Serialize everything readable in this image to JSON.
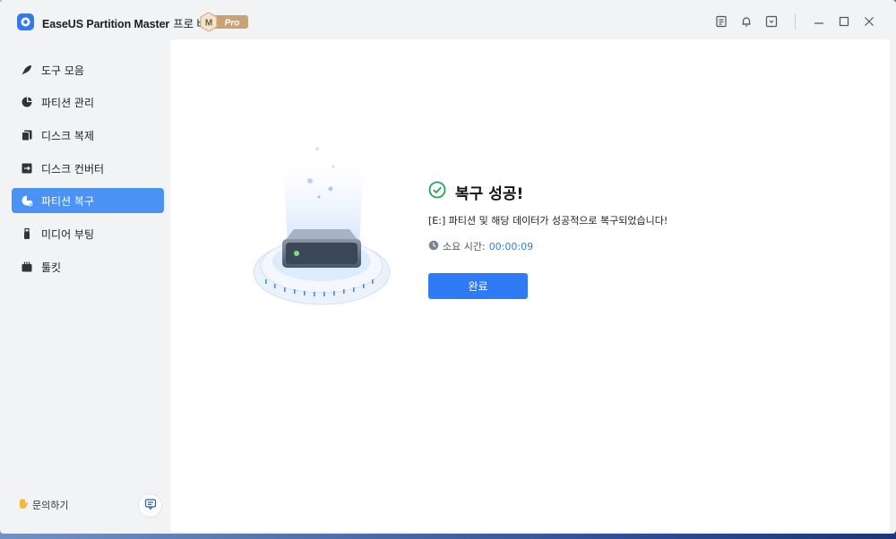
{
  "app": {
    "name": "EaseUS Partition Master",
    "edition": "프로 버전",
    "badge_letter": "M",
    "badge_text": "Pro"
  },
  "titlebar_icons": [
    "notes-icon",
    "bell-icon",
    "download-icon",
    "minimize-icon",
    "maximize-icon",
    "close-icon"
  ],
  "sidebar": {
    "items": [
      {
        "label": "도구 모음",
        "icon": "rocket-icon",
        "active": false
      },
      {
        "label": "파티션 관리",
        "icon": "pie-chart-icon",
        "active": false
      },
      {
        "label": "디스크 복제",
        "icon": "clone-icon",
        "active": false
      },
      {
        "label": "디스크 컨버터",
        "icon": "convert-icon",
        "active": false
      },
      {
        "label": "파티션 복구",
        "icon": "recovery-icon",
        "active": true
      },
      {
        "label": "미디어 부팅",
        "icon": "usb-icon",
        "active": false
      },
      {
        "label": "툴킷",
        "icon": "toolkit-icon",
        "active": false
      }
    ],
    "contact_label": "문의하기"
  },
  "result": {
    "title": "복구 성공!",
    "message": "[E:] 파티션 및 해당 데이터가 성공적으로 복구되었습니다!",
    "elapsed_label": "소요 시간:",
    "elapsed_value": "00:00:09",
    "done_label": "완료"
  },
  "colors": {
    "accent": "#2f7bf5",
    "active_nav": "#4a92f4",
    "success": "#22a35a"
  }
}
